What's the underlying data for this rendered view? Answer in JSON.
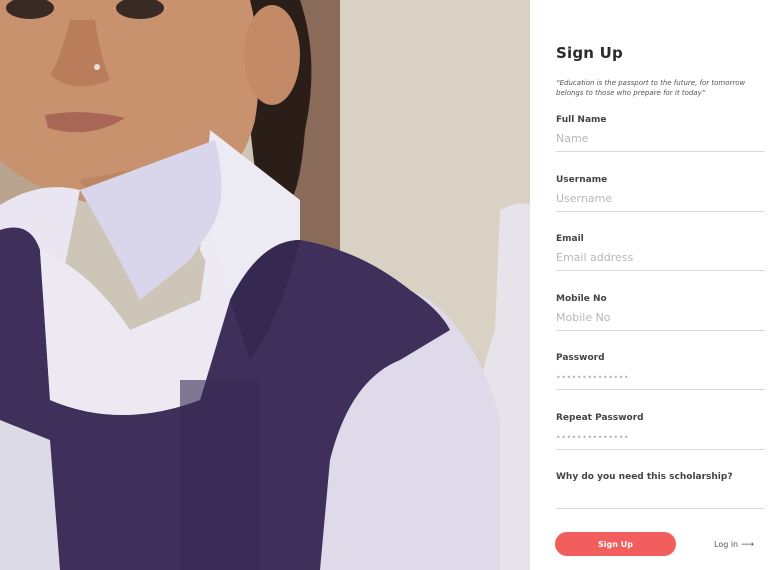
{
  "signup": {
    "title": "Sign Up",
    "quote": "“Education is the passport to the future, for tomorrow belongs to those who prepare for it today”",
    "fields": [
      {
        "label": "Full Name",
        "placeholder": "Name"
      },
      {
        "label": "Username",
        "placeholder": "Username"
      },
      {
        "label": "Email",
        "placeholder": "Email address"
      },
      {
        "label": "Mobile No",
        "placeholder": "Mobile No"
      },
      {
        "label": "Password",
        "placeholder": "••••••••••••••"
      },
      {
        "label": "Repeat Password",
        "placeholder": "••••••••••••••"
      },
      {
        "label": "Why do you need this scholarship?",
        "placeholder": ""
      }
    ],
    "submit_label": "Sign Up",
    "login_label": "Log in",
    "login_icon": "arrow-right-icon"
  },
  "colors": {
    "accent": "#f25d5d",
    "uniform": "#3e2f5b",
    "shirt": "#e7e3f0"
  }
}
